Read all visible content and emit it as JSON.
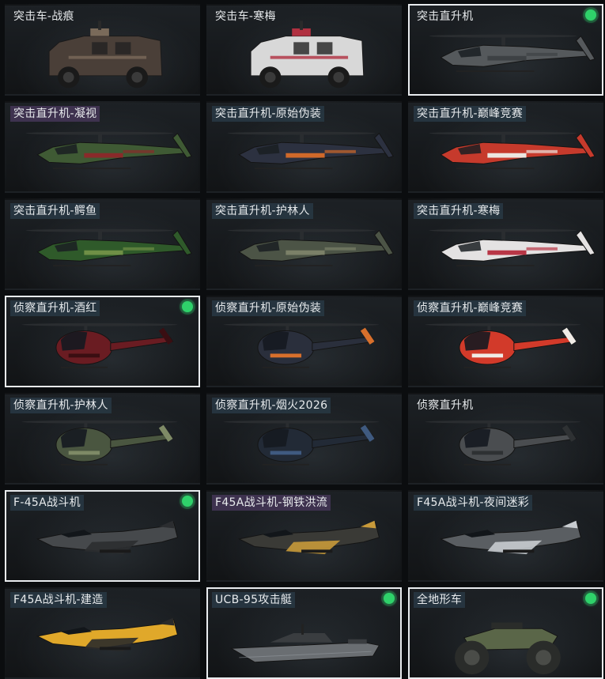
{
  "vehicles": [
    {
      "name": "突击车-战痕",
      "kind": "truck",
      "body": "#4a3f38",
      "accent": "#7a6a5a",
      "selected": false,
      "equipped": false
    },
    {
      "name": "突击车-寒梅",
      "kind": "truck",
      "body": "#d8d8d8",
      "accent": "#b03040",
      "selected": false,
      "equipped": false
    },
    {
      "name": "突击直升机",
      "kind": "attack-heli",
      "body": "#55595c",
      "accent": "#3d4144",
      "selected": true,
      "equipped": true
    },
    {
      "name": "突击直升机-凝视",
      "kind": "attack-heli",
      "body": "#3f5a34",
      "accent": "#8a2a2a",
      "selected": false,
      "equipped": false
    },
    {
      "name": "突击直升机-原始伪装",
      "kind": "attack-heli",
      "body": "#2c3140",
      "accent": "#d0692a",
      "selected": false,
      "equipped": false
    },
    {
      "name": "突击直升机-巅峰竞赛",
      "kind": "attack-heli",
      "body": "#c63a2c",
      "accent": "#ece6e0",
      "selected": false,
      "equipped": false
    },
    {
      "name": "突击直升机-鳄鱼",
      "kind": "attack-heli",
      "body": "#2f5a2a",
      "accent": "#6f8f46",
      "selected": false,
      "equipped": false
    },
    {
      "name": "突击直升机-护林人",
      "kind": "attack-heli",
      "body": "#4c5446",
      "accent": "#7b8068",
      "selected": false,
      "equipped": false
    },
    {
      "name": "突击直升机-寒梅",
      "kind": "attack-heli",
      "body": "#e4e2e2",
      "accent": "#b83646",
      "selected": false,
      "equipped": false
    },
    {
      "name": "侦察直升机-酒红",
      "kind": "scout-heli",
      "body": "#6a1c22",
      "accent": "#3a0e12",
      "selected": true,
      "equipped": true
    },
    {
      "name": "侦察直升机-原始伪装",
      "kind": "scout-heli",
      "body": "#2a2f3c",
      "accent": "#d8702c",
      "selected": false,
      "equipped": false
    },
    {
      "name": "侦察直升机-巅峰竞赛",
      "kind": "scout-heli",
      "body": "#d23a2a",
      "accent": "#f0ece6",
      "selected": false,
      "equipped": false
    },
    {
      "name": "侦察直升机-护林人",
      "kind": "scout-heli",
      "body": "#4a5640",
      "accent": "#7e8a66",
      "selected": false,
      "equipped": false
    },
    {
      "name": "侦察直升机-烟火2026",
      "kind": "scout-heli",
      "body": "#222a36",
      "accent": "#3f5a80",
      "selected": false,
      "equipped": false
    },
    {
      "name": "侦察直升机",
      "kind": "scout-heli",
      "body": "#4a4d50",
      "accent": "#2e3133",
      "selected": false,
      "equipped": false
    },
    {
      "name": "F-45A战斗机",
      "kind": "jet",
      "body": "#46494c",
      "accent": "#2b2d30",
      "selected": true,
      "equipped": true
    },
    {
      "name": "F45A战斗机-钢铁洪流",
      "kind": "jet",
      "body": "#3a3a36",
      "accent": "#c89a3a",
      "selected": false,
      "equipped": false
    },
    {
      "name": "F45A战斗机-夜间迷彩",
      "kind": "jet",
      "body": "#5a5e62",
      "accent": "#c8ccd0",
      "selected": false,
      "equipped": false
    },
    {
      "name": "F45A战斗机-建造",
      "kind": "jet",
      "body": "#e0a82a",
      "accent": "#2a2a2a",
      "selected": false,
      "equipped": false
    },
    {
      "name": "UCB-95攻击艇",
      "kind": "boat",
      "body": "#6a6e72",
      "accent": "#3a3d40",
      "selected": true,
      "equipped": true
    },
    {
      "name": "全地形车",
      "kind": "atv",
      "body": "#5a6648",
      "accent": "#2a2c2a",
      "selected": true,
      "equipped": true
    }
  ]
}
